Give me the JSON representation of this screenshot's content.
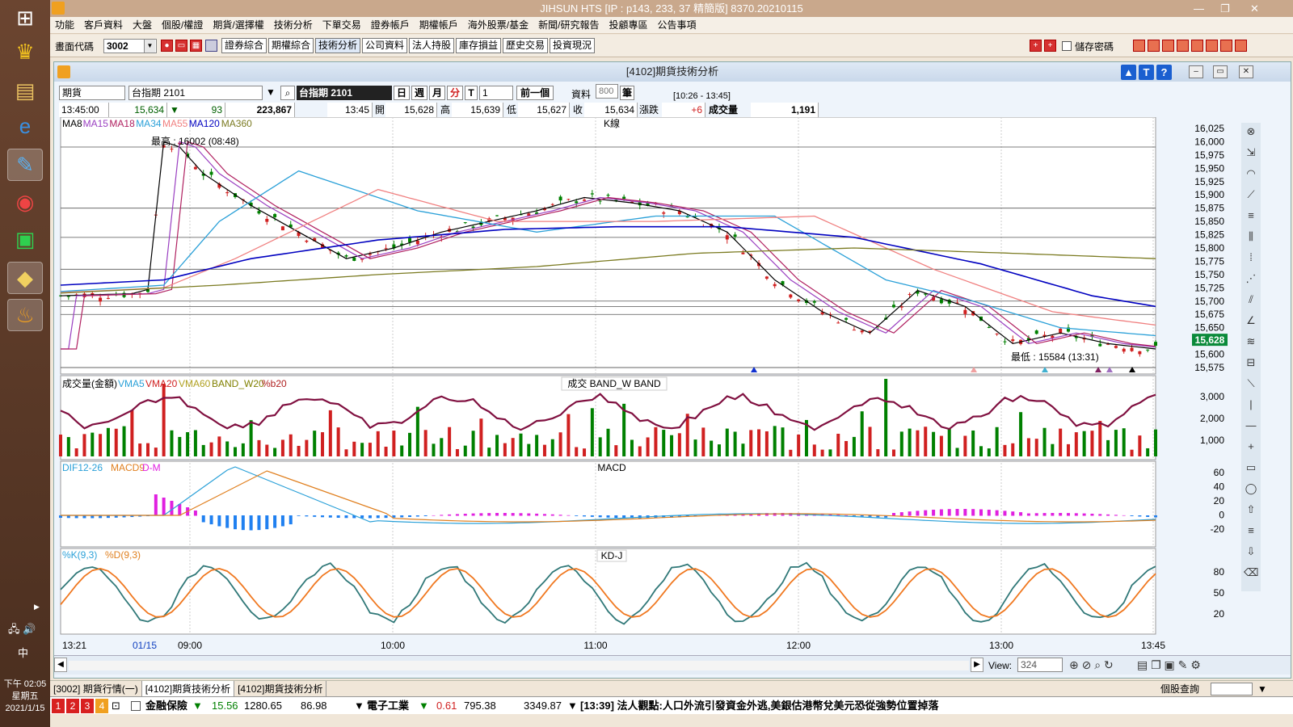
{
  "taskbar": {
    "clock_time": "下午 02:05",
    "clock_day": "星期五",
    "clock_date": "2021/1/15",
    "ime": "中"
  },
  "app": {
    "title": "JIHSUN HTS     [IP : p143, 233, 37 精簡版] 8370.20210115"
  },
  "menu": [
    "功能",
    "客戶資料",
    "大盤",
    "個股/權證",
    "期貨/選擇權",
    "技術分析",
    "下單交易",
    "證券帳戶",
    "期權帳戶",
    "海外股票/基金",
    "新聞/研究報告",
    "投顧專區",
    "公告事項"
  ],
  "toolbar": {
    "code_label": "畫面代碼",
    "code_value": "3002",
    "buttons": [
      "證券綜合",
      "期權綜合",
      "技術分析",
      "公司資料",
      "法人持股",
      "庫存損益",
      "歷史交易",
      "投資現況"
    ],
    "save_password": "儲存密碼"
  },
  "window": {
    "title": "[4102]期貨技術分析",
    "help_buttons": [
      "▲",
      "T",
      "?"
    ]
  },
  "controls": {
    "market": "期貨",
    "contract": "台指期 2101",
    "contract_display": "台指期 2101",
    "periods": [
      "日",
      "週",
      "月",
      "分",
      "T"
    ],
    "interval": "1",
    "prev_btn": "前一個",
    "data_label": "資料",
    "data_count": "800",
    "unit": "筆",
    "range": "[10:26 - 13:45]"
  },
  "quote": {
    "time": "13:45:00",
    "price": "15,634",
    "change": "93",
    "amount": "223,867",
    "qtime": "13:45",
    "open_label": "開",
    "open": "15,628",
    "high_label": "高",
    "high": "15,639",
    "low_label": "低",
    "low": "15,627",
    "close_label": "收",
    "close": "15,634",
    "chg_label": "漲跌",
    "chg": "+6",
    "vol_label": "成交量",
    "vol": "1,191"
  },
  "panels": {
    "kline": {
      "title": "K線",
      "legend": [
        "MA8",
        "MA15",
        "MA18",
        "MA34",
        "MA55",
        "MA120",
        "MA360"
      ],
      "legend_colors": [
        "#000000",
        "#9a3fc1",
        "#b02060",
        "#2aa0d8",
        "#f08080",
        "#0000c0",
        "#7a7a20"
      ],
      "max_label": "最高 : 16002 (08:48)",
      "min_label": "最低 : 15584 (13:31)",
      "last_price": "15,628",
      "y_ticks": [
        "16,025",
        "16,000",
        "15,975",
        "15,950",
        "15,925",
        "15,900",
        "15,875",
        "15,850",
        "15,825",
        "15,800",
        "15,775",
        "15,750",
        "15,725",
        "15,700",
        "15,675",
        "15,650",
        "15,628",
        "15,600",
        "15,575"
      ]
    },
    "volume": {
      "title": "成交  BAND_W  BAND",
      "legend": [
        "成交量(金額)",
        "VMA5",
        "VMA20",
        "VMA60",
        "BAND_W20",
        "%b20"
      ],
      "legend_colors": [
        "#000000",
        "#2aa0d8",
        "#d02020",
        "#b0a020",
        "#808000",
        "#b02020"
      ],
      "y_ticks": [
        "3,000",
        "2,000",
        "1,000"
      ]
    },
    "macd": {
      "title": "MACD",
      "legend": [
        "DIF12-26",
        "MACD9",
        "D-M"
      ],
      "legend_colors": [
        "#2aa0d8",
        "#e08020",
        "#e020e0"
      ],
      "y_ticks": [
        "60",
        "40",
        "20",
        "0",
        "-20"
      ]
    },
    "kd": {
      "title": "KD-J",
      "legend": [
        "%K(9,3)",
        "%D(9,3)"
      ],
      "legend_colors": [
        "#2aa0d8",
        "#e08020"
      ],
      "y_ticks": [
        "80",
        "50",
        "20"
      ]
    }
  },
  "time_axis": [
    "13:21",
    "01/15",
    "09:00",
    "10:00",
    "11:00",
    "12:00",
    "13:00",
    "13:45"
  ],
  "view": {
    "label": "View:",
    "value": "324"
  },
  "tabs": [
    "[3002] 期貨行情(一)",
    "[4102]期貨技術分析",
    "[4102]期貨技術分析"
  ],
  "tabs_right": "個股查詢",
  "ticker": {
    "pages": [
      "1",
      "2",
      "3",
      "4"
    ],
    "sector1": "金融保險",
    "s1_arrow": "▼",
    "s1_chg": "15.56",
    "s1_val": "1280.65",
    "s1_vol": "86.98",
    "sector2": "電子工業",
    "s2_arrow": "▼",
    "s2_chg": "0.61",
    "s2_val": "795.38",
    "s2_vol": "3349.87",
    "news": "[13:39]  法人觀點:人口外流引發資金外逃,美銀估港幣兌美元恐從強勢位置掉落"
  },
  "chart_data": {
    "type": "line",
    "title": "K線",
    "ylim": [
      15575,
      16025
    ],
    "x_labels": [
      "13:21",
      "01/15",
      "09:00",
      "10:00",
      "11:00",
      "12:00",
      "13:00",
      "13:45"
    ],
    "series": [
      {
        "name": "MA8",
        "points": [
          [
            0,
            15710
          ],
          [
            9,
            15714
          ],
          [
            11,
            15722
          ],
          [
            13,
            16000
          ],
          [
            15,
            15990
          ],
          [
            18,
            15940
          ],
          [
            24,
            15880
          ],
          [
            30,
            15830
          ],
          [
            36,
            15780
          ],
          [
            42,
            15800
          ],
          [
            48,
            15830
          ],
          [
            54,
            15850
          ],
          [
            60,
            15870
          ],
          [
            66,
            15895
          ],
          [
            72,
            15885
          ],
          [
            78,
            15870
          ],
          [
            84,
            15830
          ],
          [
            90,
            15740
          ],
          [
            96,
            15680
          ],
          [
            102,
            15640
          ],
          [
            108,
            15720
          ],
          [
            114,
            15690
          ],
          [
            120,
            15620
          ],
          [
            126,
            15640
          ],
          [
            132,
            15620
          ],
          [
            138,
            15610
          ]
        ]
      },
      {
        "name": "MA120",
        "points": [
          [
            0,
            15730
          ],
          [
            13,
            15740
          ],
          [
            24,
            15780
          ],
          [
            40,
            15815
          ],
          [
            56,
            15835
          ],
          [
            70,
            15840
          ],
          [
            84,
            15840
          ],
          [
            100,
            15820
          ],
          [
            116,
            15770
          ],
          [
            130,
            15710
          ],
          [
            138,
            15690
          ]
        ]
      },
      {
        "name": "MA360",
        "points": [
          [
            0,
            15715
          ],
          [
            20,
            15730
          ],
          [
            40,
            15750
          ],
          [
            60,
            15765
          ],
          [
            80,
            15790
          ],
          [
            100,
            15800
          ],
          [
            120,
            15790
          ],
          [
            138,
            15780
          ]
        ]
      }
    ]
  }
}
